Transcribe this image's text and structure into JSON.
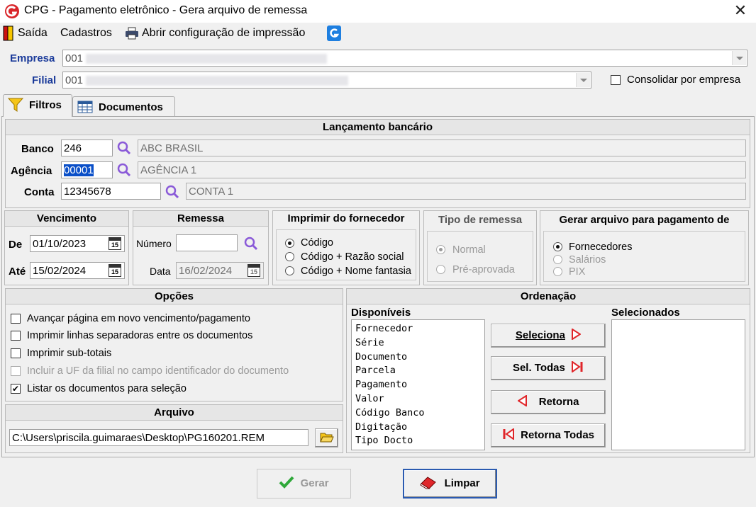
{
  "window": {
    "title": "CPG  -  Pagamento eletrônico - Gera arquivo de remessa",
    "close": "✕"
  },
  "menu": {
    "exit": "Saída",
    "registers": "Cadastros",
    "print_config": "Abrir configuração de impressão"
  },
  "header": {
    "empresa_label": "Empresa",
    "empresa_code": "001",
    "filial_label": "Filial",
    "filial_code": "001",
    "consolidate_label": "Consolidar por empresa"
  },
  "tabs": [
    {
      "label": "Filtros"
    },
    {
      "label": "Documentos"
    }
  ],
  "bank_entry": {
    "title": "Lançamento bancário",
    "banco_label": "Banco",
    "banco_value": "246",
    "banco_name": "ABC BRASIL",
    "agencia_label": "Agência",
    "agencia_value": "00001",
    "agencia_name": "AGÊNCIA 1",
    "conta_label": "Conta",
    "conta_value": "12345678",
    "conta_name": "CONTA 1"
  },
  "vencimento": {
    "title": "Vencimento",
    "de_label": "De",
    "de_value": "01/10/2023",
    "ate_label": "Até",
    "ate_value": "15/02/2024",
    "cal_icon": "15"
  },
  "remessa": {
    "title": "Remessa",
    "numero_label": "Número",
    "numero_value": "",
    "data_label": "Data",
    "data_value": "16/02/2024"
  },
  "imprimir": {
    "title": "Imprimir do fornecedor",
    "options": [
      "Código",
      "Código + Razão social",
      "Código + Nome fantasia"
    ],
    "selected": 0
  },
  "tipo_remessa": {
    "title": "Tipo de remessa",
    "options": [
      "Normal",
      "Pré-aprovada"
    ],
    "selected": 0
  },
  "gerar_para": {
    "title": "Gerar arquivo para pagamento de",
    "options": [
      "Fornecedores",
      "Salários",
      "PIX"
    ],
    "selected": 0
  },
  "opcoes": {
    "title": "Opções",
    "items": [
      {
        "label": "Avançar página em novo vencimento/pagamento",
        "checked": false,
        "enabled": true
      },
      {
        "label": "Imprimir linhas separadoras entre os documentos",
        "checked": false,
        "enabled": true
      },
      {
        "label": "Imprimir sub-totais",
        "checked": false,
        "enabled": true
      },
      {
        "label": "Incluir a UF da filial no campo identificador do documento",
        "checked": false,
        "enabled": false
      },
      {
        "label": "Listar os documentos para seleção",
        "checked": true,
        "enabled": true
      }
    ]
  },
  "arquivo": {
    "title": "Arquivo",
    "path": "C:\\Users\\priscila.guimaraes\\Desktop\\PG160201.REM"
  },
  "ordenacao": {
    "title": "Ordenação",
    "available_label": "Disponíveis",
    "selected_label": "Selecionados",
    "available": [
      "Fornecedor",
      "Série",
      "Documento",
      "Parcela",
      "Pagamento",
      "Valor",
      "Código Banco",
      "Digitação",
      "Tipo Docto"
    ],
    "selected": [],
    "btn_select": "Seleciona",
    "btn_select_all": "Sel. Todas",
    "btn_return": "Retorna",
    "btn_return_all": "Retorna Todas"
  },
  "footer": {
    "generate": "Gerar",
    "clear": "Limpar"
  },
  "colors": {
    "accent_blue": "#1a3a9a",
    "red_icon": "#e0262a",
    "search_purple": "#8a5ad8",
    "check_green": "#2fa83a"
  }
}
